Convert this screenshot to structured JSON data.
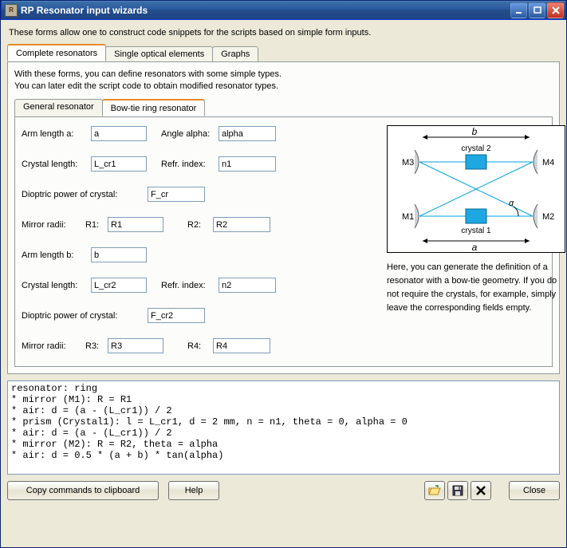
{
  "window": {
    "title": "RP Resonator input wizards"
  },
  "header": "These forms allow one to construct code snippets for the scripts based on simple form inputs.",
  "top_tabs": {
    "t0": "Complete resonators",
    "t1": "Single optical elements",
    "t2": "Graphs"
  },
  "explain": {
    "l1": "With these forms, you can define resonators with some simple types.",
    "l2": "You can later edit the script code to obtain modified resonator types."
  },
  "inner_tabs": {
    "t0": "General resonator",
    "t1": "Bow-tie ring resonator"
  },
  "form": {
    "arm_a_label": "Arm length a:",
    "arm_a": "a",
    "angle_label": "Angle alpha:",
    "angle": "alpha",
    "crystal_len1_label": "Crystal length:",
    "crystal_len1": "L_cr1",
    "refr1_label": "Refr. index:",
    "refr1": "n1",
    "diop1_label": "Dioptric power of crystal:",
    "diop1": "F_cr",
    "mirror_radii_label": "Mirror radii:",
    "r1_label": "R1:",
    "r1": "R1",
    "r2_label": "R2:",
    "r2": "R2",
    "arm_b_label": "Arm length b:",
    "arm_b": "b",
    "crystal_len2_label": "Crystal length:",
    "crystal_len2": "L_cr2",
    "refr2_label": "Refr. index:",
    "refr2": "n2",
    "diop2_label": "Dioptric power of crystal:",
    "diop2": "F_cr2",
    "r3_label": "R3:",
    "r3": "R3",
    "r4_label": "R4:",
    "r4": "R4"
  },
  "diagram": {
    "b": "b",
    "a": "a",
    "alpha": "α",
    "c1": "crystal 1",
    "c2": "crystal 2",
    "m1": "M1",
    "m2": "M2",
    "m3": "M3",
    "m4": "M4"
  },
  "diagram_text": "Here, you can generate the definition of a resonator with a bow-tie geometry. If you do not require the crystals, for example, simply leave the corresponding fields empty.",
  "code": "resonator: ring\n* mirror (M1): R = R1\n* air: d = (a - (L_cr1)) / 2\n* prism (Crystal1): l = L_cr1, d = 2 mm, n = n1, theta = 0, alpha = 0\n* air: d = (a - (L_cr1)) / 2\n* mirror (M2): R = R2, theta = alpha\n* air: d = 0.5 * (a + b) * tan(alpha)",
  "buttons": {
    "copy": "Copy commands to clipboard",
    "help": "Help",
    "close": "Close"
  }
}
